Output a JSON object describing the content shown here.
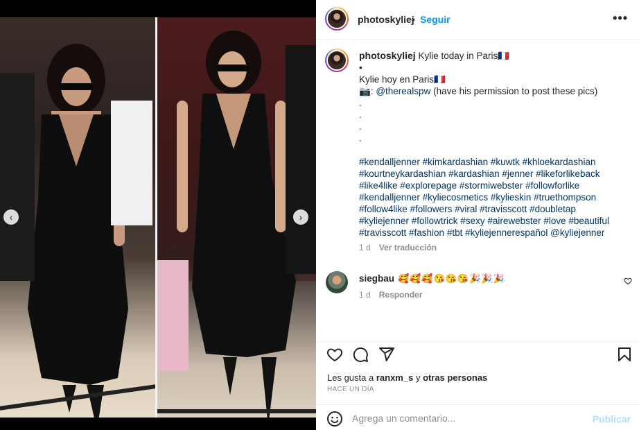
{
  "header": {
    "username": "photoskyliej",
    "separator": "•",
    "follow_label": "Seguir",
    "more_icon": "more-horizontal-icon"
  },
  "media": {
    "left_chevron": "‹",
    "right_chevron": "›",
    "carousel_count": 2,
    "carousel_active": 2
  },
  "caption": {
    "username": "photoskyliej",
    "title": "Kylie today in Paris🇫🇷",
    "bullet": "•",
    "line_es": "Kylie hoy en Paris🇫🇷",
    "camera": "📷",
    "credit_handle": "@therealspw",
    "credit_note": "(have his permission to post these pics)",
    "dots": [
      ".",
      ".",
      ".",
      "."
    ],
    "hashtags": [
      "#kendalljenner #kimkardashian #kuwtk #khloekardashian",
      "#kourtneykardashian #kardashian #jenner #likeforlikeback",
      "#like4like #explorepage #stormiwebster #followforlike",
      "#kendalljenner #kyliecosmetics #kylieskin #truethompson",
      "#follow4like #followers #viral #travisscott #doubletap",
      "#kyliejenner #followtrick #sexy #airewebster #love #beautiful",
      "#travisscott #fashion #tbt #kyliejennerespañol @kyliejenner"
    ],
    "age": "1 d",
    "translate_label": "Ver traducción"
  },
  "comment": {
    "username": "siegbau",
    "text": "🥰🥰🥰😘😘😘🎉🎉🎉",
    "age": "1 d",
    "reply_label": "Responder",
    "like_icon": "heart-outline-icon"
  },
  "actions": {
    "like_icon": "heart-outline-icon",
    "comment_icon": "comment-icon",
    "share_icon": "paper-plane-icon",
    "save_icon": "bookmark-icon"
  },
  "likes": {
    "prefix": "Les gusta a",
    "user": "ranxm_s",
    "conj": "y",
    "others": "otras personas"
  },
  "timestamp": "HACE UN DÍA",
  "add_comment": {
    "placeholder": "Agrega un comentario...",
    "publish_label": "Publicar",
    "emoji_icon": "smiley-icon"
  },
  "colors": {
    "accent": "#0095f6",
    "link": "#00376b",
    "muted": "#8e8e8e",
    "publish_disabled": "#b2dffc"
  }
}
